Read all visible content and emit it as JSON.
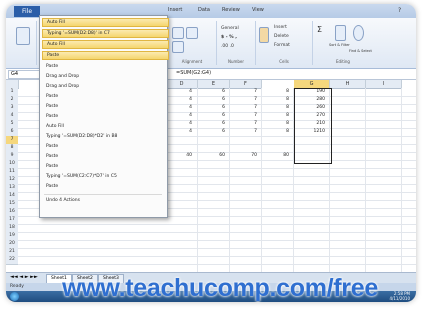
{
  "ribbon": {
    "file_tab": "File",
    "tabs": [
      "Insert",
      "Data",
      "Review",
      "View"
    ],
    "groups": [
      "Alignment",
      "Number",
      "Cells",
      "Editing"
    ],
    "font_label": "General",
    "cells_items": [
      "Insert",
      "Delete",
      "Format"
    ],
    "editing_items": [
      "Sort & Filter",
      "Find & Select"
    ]
  },
  "formula_bar": {
    "name_box": "G4",
    "formula": "=SUM(G2:G4)"
  },
  "columns": [
    "D",
    "E",
    "F",
    "G",
    "H",
    "I"
  ],
  "rows": [
    "1",
    "2",
    "3",
    "4",
    "5",
    "6",
    "7",
    "8",
    "9",
    "10",
    "11",
    "12",
    "13",
    "14",
    "15",
    "16",
    "17",
    "18",
    "19",
    "20",
    "21",
    "22"
  ],
  "cells": {
    "col_d": [
      "4",
      "4",
      "4",
      "4",
      "4",
      "4",
      "40"
    ],
    "col_e": [
      "6",
      "6",
      "6",
      "6",
      "6",
      "6",
      "60"
    ],
    "col_f": [
      "7",
      "7",
      "7",
      "7",
      "7",
      "7",
      "70"
    ],
    "col_g": [
      "8",
      "8",
      "8",
      "8",
      "8",
      "8",
      "80"
    ],
    "col_h": [
      "190",
      "280",
      "260",
      "270",
      "210",
      "1210"
    ]
  },
  "menu": {
    "items": [
      {
        "label": "Auto Fill"
      },
      {
        "label": "Typing '=SUM(D2:D8)' in C7"
      },
      {
        "label": "Auto Fill"
      },
      {
        "label": "Paste"
      },
      {
        "label": "Paste"
      },
      {
        "label": "Drag and Drop"
      },
      {
        "label": "Drag and Drop"
      },
      {
        "label": "Paste"
      },
      {
        "label": "Paste"
      },
      {
        "label": "Paste"
      },
      {
        "label": "Auto Fill"
      },
      {
        "label": "Typing '=SUM(D2:D8)*D2' in B8"
      },
      {
        "label": "Paste"
      },
      {
        "label": "Paste"
      },
      {
        "label": "Paste"
      },
      {
        "label": "Typing '=SUM(C2:C7)*D7' in C5"
      },
      {
        "label": "Paste"
      },
      {
        "label": "Undo 4 Actions"
      }
    ]
  },
  "sheets": [
    "Sheet1",
    "Sheet2",
    "Sheet3"
  ],
  "status": "Ready",
  "clock": {
    "time": "2:58 PM",
    "date": "4/11/2010"
  },
  "watermark": "www.teachucomp.com/free"
}
